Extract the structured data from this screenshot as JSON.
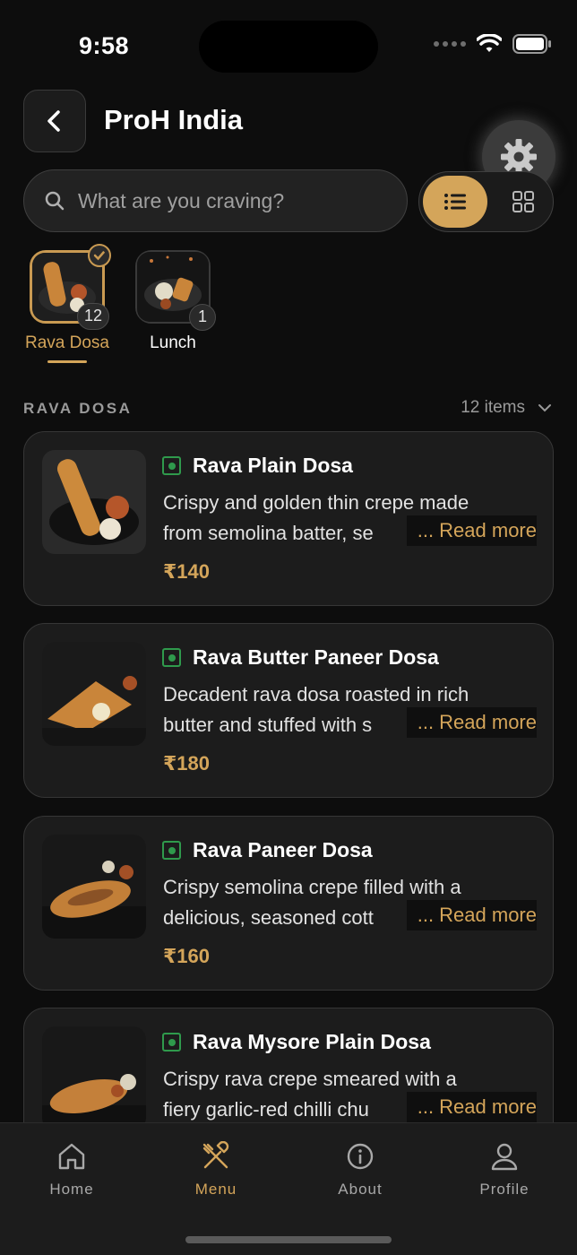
{
  "status_bar": {
    "time": "9:58"
  },
  "header": {
    "title": "ProH India"
  },
  "search": {
    "placeholder": "What are you craving?"
  },
  "categories": [
    {
      "label": "Rava Dosa",
      "count": "12",
      "selected": true
    },
    {
      "label": "Lunch",
      "count": "1",
      "selected": false
    }
  ],
  "section": {
    "title": "RAVA DOSA",
    "count_label": "12 items"
  },
  "items": [
    {
      "name": "Rava Plain Dosa",
      "desc_line1": "Crispy and golden thin crepe made",
      "desc_line2": "from semolina batter, se",
      "read_more": "... Read more",
      "price": "₹140"
    },
    {
      "name": "Rava Butter Paneer Dosa",
      "desc_line1": "Decadent rava dosa roasted in rich",
      "desc_line2": "butter and stuffed with s",
      "read_more": "... Read more",
      "price": "₹180"
    },
    {
      "name": "Rava Paneer Dosa",
      "desc_line1": "Crispy semolina crepe filled with a",
      "desc_line2": "delicious, seasoned cott",
      "read_more": "... Read more",
      "price": "₹160"
    },
    {
      "name": "Rava Mysore Plain Dosa",
      "desc_line1": "Crispy rava crepe smeared with a",
      "desc_line2": "fiery garlic-red chilli chu",
      "read_more": "... Read more",
      "price": ""
    }
  ],
  "nav": {
    "home": "Home",
    "menu": "Menu",
    "about": "About",
    "profile": "Profile"
  },
  "colors": {
    "accent": "#d4a55a",
    "background": "#0d0d0d",
    "card": "#1c1c1c",
    "veg": "#2f9a4c"
  },
  "icons": [
    "chevron-left-icon",
    "gear-icon",
    "search-icon",
    "list-icon",
    "grid-icon",
    "check-icon",
    "chevron-down-icon",
    "veg-mark-icon",
    "home-icon",
    "fork-knife-icon",
    "info-icon",
    "user-icon",
    "wifi-icon",
    "battery-icon"
  ]
}
